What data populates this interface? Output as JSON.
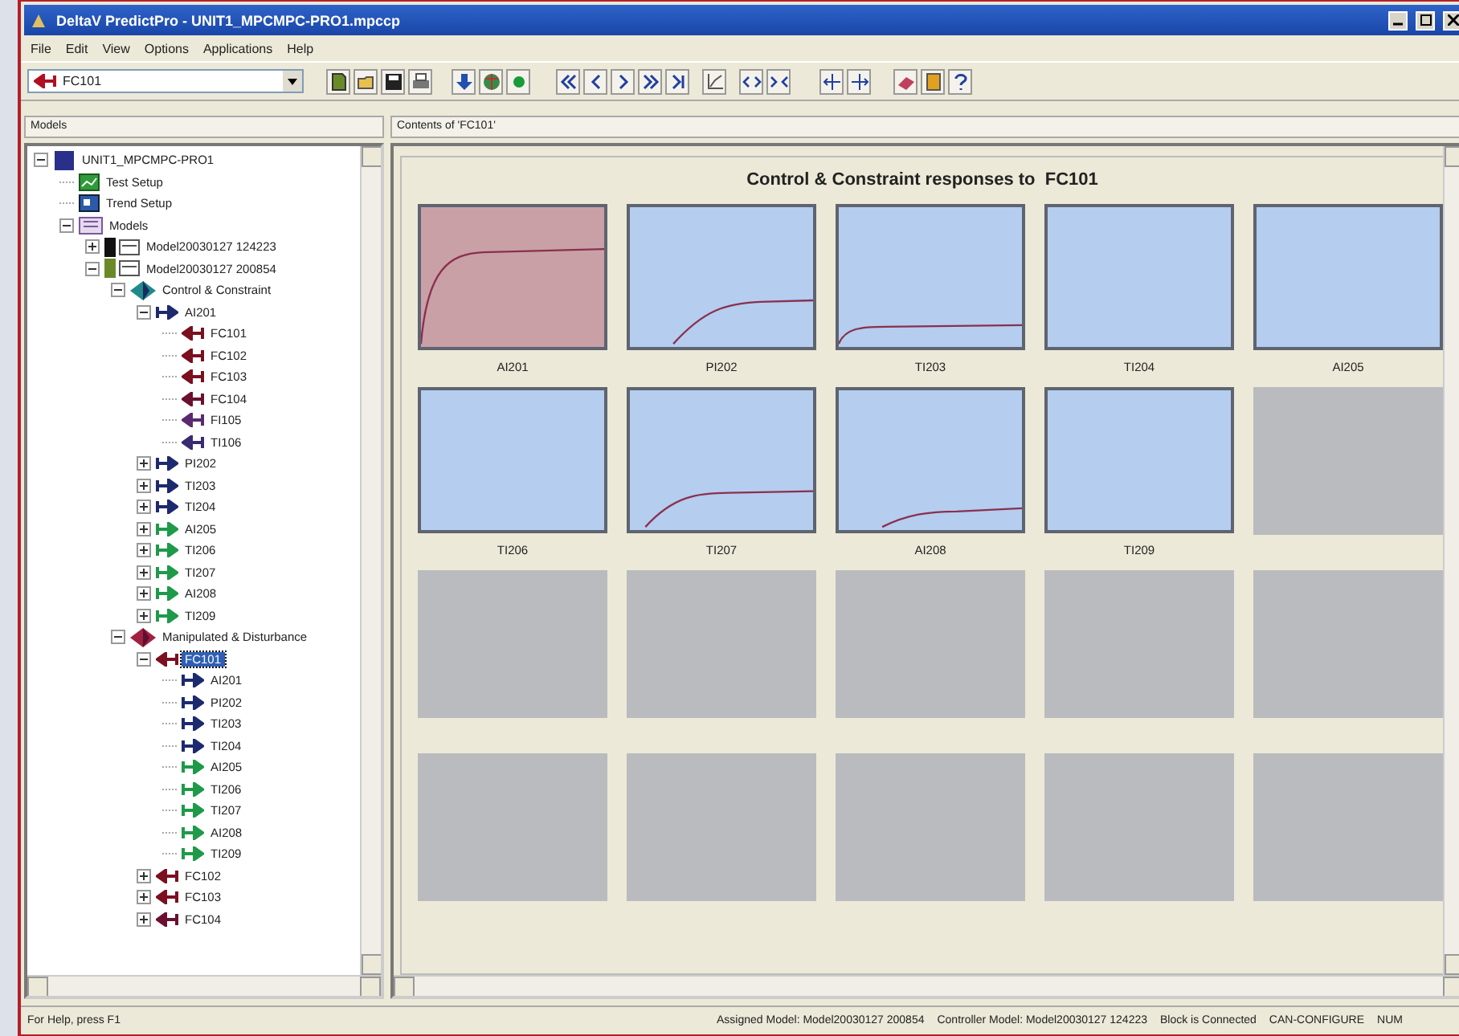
{
  "window": {
    "title": "DeltaV PredictPro - UNIT1_MPCMPC-PRO1.mpccp"
  },
  "menu": [
    "File",
    "Edit",
    "View",
    "Options",
    "Applications",
    "Help"
  ],
  "toolbar": {
    "selector": {
      "value": "FC101"
    }
  },
  "panes": {
    "left_header": "Models",
    "right_header": "Contents of 'FC101'"
  },
  "tree": [
    {
      "label": "UNIT1_MPCMPC-PRO1",
      "kind": "project",
      "expanded": true,
      "selected": false,
      "children": [
        {
          "label": "Test Setup",
          "kind": "test",
          "selected": false
        },
        {
          "label": "Trend Setup",
          "kind": "trend",
          "selected": false
        },
        {
          "label": "Models",
          "kind": "models",
          "expanded": true,
          "selected": false,
          "children": [
            {
              "label": "Model20030127 124223",
              "kind": "model",
              "expanded": false,
              "selected": false
            },
            {
              "label": "Model20030127 200854",
              "kind": "model-active",
              "expanded": true,
              "selected": false,
              "children": [
                {
                  "label": "Control & Constraint",
                  "kind": "group-cc",
                  "expanded": true,
                  "selected": false,
                  "children": [
                    {
                      "label": "AI201",
                      "kind": "cv",
                      "color": "#1d2a6e",
                      "expanded": true,
                      "selected": false,
                      "children": [
                        {
                          "label": "FC101",
                          "kind": "mv",
                          "color": "#7a1020",
                          "selected": false
                        },
                        {
                          "label": "FC102",
                          "kind": "mv",
                          "color": "#7a1020",
                          "selected": false
                        },
                        {
                          "label": "FC103",
                          "kind": "mv",
                          "color": "#7a1020",
                          "selected": false
                        },
                        {
                          "label": "FC104",
                          "kind": "mv",
                          "color": "#6a1030",
                          "selected": false
                        },
                        {
                          "label": "FI105",
                          "kind": "mv",
                          "color": "#5a2a70",
                          "selected": false
                        },
                        {
                          "label": "TI106",
                          "kind": "mv",
                          "color": "#3a2a70",
                          "selected": false
                        }
                      ]
                    },
                    {
                      "label": "PI202",
                      "kind": "cv",
                      "color": "#1d2a6e",
                      "expanded": false,
                      "selected": false
                    },
                    {
                      "label": "TI203",
                      "kind": "cv",
                      "color": "#1d2a6e",
                      "expanded": false,
                      "selected": false
                    },
                    {
                      "label": "TI204",
                      "kind": "cv",
                      "color": "#1d2a6e",
                      "expanded": false,
                      "selected": false
                    },
                    {
                      "label": "AI205",
                      "kind": "cv",
                      "color": "#1f9a4a",
                      "expanded": false,
                      "selected": false
                    },
                    {
                      "label": "TI206",
                      "kind": "cv",
                      "color": "#1f9a4a",
                      "expanded": false,
                      "selected": false
                    },
                    {
                      "label": "TI207",
                      "kind": "cv",
                      "color": "#1f9a4a",
                      "expanded": false,
                      "selected": false
                    },
                    {
                      "label": "AI208",
                      "kind": "cv",
                      "color": "#1f9a4a",
                      "expanded": false,
                      "selected": false
                    },
                    {
                      "label": "TI209",
                      "kind": "cv",
                      "color": "#1f9a4a",
                      "expanded": false,
                      "selected": false
                    }
                  ]
                },
                {
                  "label": "Manipulated & Disturbance",
                  "kind": "group-md",
                  "expanded": true,
                  "selected": false,
                  "children": [
                    {
                      "label": "FC101",
                      "kind": "mv",
                      "color": "#7a1020",
                      "expanded": true,
                      "selected": true,
                      "children": [
                        {
                          "label": "AI201",
                          "kind": "cv",
                          "color": "#1d2a6e",
                          "selected": false
                        },
                        {
                          "label": "PI202",
                          "kind": "cv",
                          "color": "#1d2a6e",
                          "selected": false
                        },
                        {
                          "label": "TI203",
                          "kind": "cv",
                          "color": "#1d2a6e",
                          "selected": false
                        },
                        {
                          "label": "TI204",
                          "kind": "cv",
                          "color": "#1d2a6e",
                          "selected": false
                        },
                        {
                          "label": "AI205",
                          "kind": "cv",
                          "color": "#1f9a4a",
                          "selected": false
                        },
                        {
                          "label": "TI206",
                          "kind": "cv",
                          "color": "#1f9a4a",
                          "selected": false
                        },
                        {
                          "label": "TI207",
                          "kind": "cv",
                          "color": "#1f9a4a",
                          "selected": false
                        },
                        {
                          "label": "AI208",
                          "kind": "cv",
                          "color": "#1f9a4a",
                          "selected": false
                        },
                        {
                          "label": "TI209",
                          "kind": "cv",
                          "color": "#1f9a4a",
                          "selected": false
                        }
                      ]
                    },
                    {
                      "label": "FC102",
                      "kind": "mv",
                      "color": "#7a1020",
                      "expanded": false,
                      "selected": false
                    },
                    {
                      "label": "FC103",
                      "kind": "mv",
                      "color": "#7a1020",
                      "expanded": false,
                      "selected": false
                    },
                    {
                      "label": "FC104",
                      "kind": "mv",
                      "color": "#6a1030",
                      "expanded": false,
                      "selected": false
                    }
                  ]
                }
              ]
            }
          ]
        }
      ]
    }
  ],
  "content": {
    "title": "Control & Constraint responses to  FC101",
    "tiles": [
      {
        "label": "AI201",
        "kind": "fast",
        "selected": true
      },
      {
        "label": "PI202",
        "kind": "delayed",
        "selected": false
      },
      {
        "label": "TI203",
        "kind": "small",
        "selected": false
      },
      {
        "label": "TI204",
        "kind": "flat",
        "selected": false
      },
      {
        "label": "AI205",
        "kind": "flat",
        "selected": false
      },
      {
        "label": "TI206",
        "kind": "flat",
        "selected": false
      },
      {
        "label": "TI207",
        "kind": "moderate",
        "selected": false
      },
      {
        "label": "AI208",
        "kind": "late",
        "selected": false
      },
      {
        "label": "TI209",
        "kind": "flat",
        "selected": false
      },
      {
        "kind": "empty"
      },
      {
        "kind": "empty"
      },
      {
        "kind": "empty"
      },
      {
        "kind": "empty"
      },
      {
        "kind": "empty"
      },
      {
        "kind": "empty"
      },
      {
        "kind": "empty"
      },
      {
        "kind": "empty"
      },
      {
        "kind": "empty"
      },
      {
        "kind": "empty"
      },
      {
        "kind": "empty"
      }
    ]
  },
  "status_bar": [
    "For Help, press F1",
    "Assigned Model: Model20030127 200854",
    "Controller Model: Model20030127 124223",
    "Block is Connected",
    "CAN-CONFIGURE",
    "NUM"
  ]
}
